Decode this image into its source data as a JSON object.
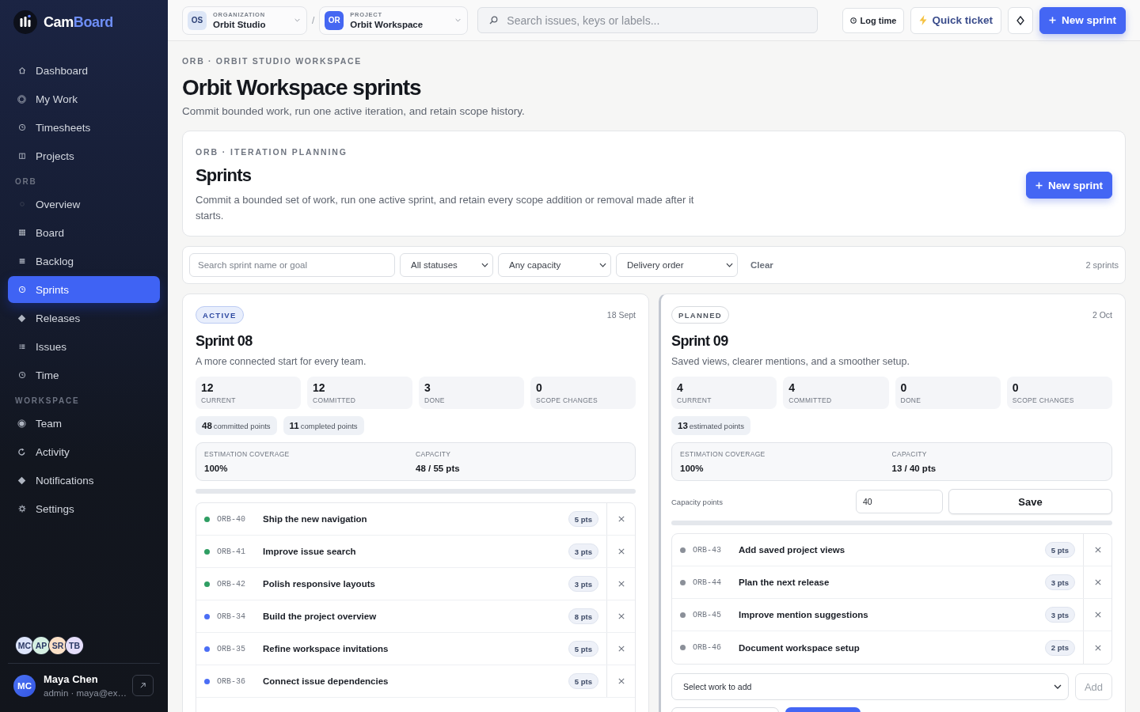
{
  "sidebar": {
    "brand": {
      "part_1": "Cam",
      "part_2": "Board"
    },
    "sections": [
      {
        "items": [
          {
            "label": "Dashboard",
            "selected": false
          },
          {
            "label": "My Work",
            "selected": false
          },
          {
            "label": "Timesheets",
            "selected": false
          },
          {
            "label": "Projects",
            "selected": false
          }
        ]
      },
      {
        "label": "ORB",
        "items": [
          {
            "label": "Overview",
            "selected": false
          },
          {
            "label": "Board",
            "selected": false
          },
          {
            "label": "Backlog",
            "selected": false
          },
          {
            "label": "Sprints",
            "selected": true
          },
          {
            "label": "Releases",
            "selected": false
          },
          {
            "label": "Issues",
            "selected": false
          },
          {
            "label": "Time",
            "selected": false
          }
        ]
      },
      {
        "label": "WORKSPACE",
        "items": [
          {
            "label": "Team",
            "selected": false
          },
          {
            "label": "Activity",
            "selected": false
          },
          {
            "label": "Notifications",
            "selected": false
          },
          {
            "label": "Settings",
            "selected": false
          }
        ]
      }
    ],
    "team": [
      {
        "initials": "MC",
        "color": "#dde5fb"
      },
      {
        "initials": "AP",
        "color": "#d5efe2"
      },
      {
        "initials": "SR",
        "color": "#fbe0c6"
      },
      {
        "initials": "TB",
        "color": "#e5defa"
      }
    ],
    "user": {
      "initials": "MC",
      "name": "Maya Chen",
      "detail": "admin · maya@ex…"
    }
  },
  "top_bar": {
    "organization": {
      "badge": "OS",
      "label": "ORGANIZATION",
      "name": "Orbit Studio"
    },
    "separator": "/",
    "project": {
      "badge": "OR",
      "label": "PROJECT",
      "name": "Orbit Workspace"
    },
    "search": {
      "placeholder": "Search issues, keys or labels..."
    },
    "buttons": [
      {
        "kind": "log",
        "label": "Log time"
      },
      {
        "kind": "quick",
        "label": "Quick ticket"
      },
      {
        "kind": "icon"
      },
      {
        "kind": "primary",
        "label": "New sprint"
      }
    ]
  },
  "page": {
    "breadcrumb": "ORB · ORBIT STUDIO WORKSPACE",
    "title": "Orbit Workspace sprints",
    "subtitle": "Commit bounded work, run one active iteration, and retain scope history."
  },
  "planning": {
    "eyebrow": "ORB · ITERATION PLANNING",
    "title": "Sprints",
    "description": "Commit a bounded set of work, run one active sprint, and retain every scope addition or removal made after it starts.",
    "button": "New sprint"
  },
  "filters": {
    "search": {
      "placeholder": "Search sprint name or goal"
    },
    "selects": [
      {
        "value": "All statuses"
      },
      {
        "value": "Any capacity"
      },
      {
        "value": "Delivery order"
      }
    ],
    "clear": "Clear",
    "count": "2 sprints"
  },
  "sprints": [
    {
      "badge": {
        "label": "ACTIVE",
        "kind": "active"
      },
      "date": "18 Sept",
      "title": "Sprint 08",
      "description": "A more connected start for every team.",
      "stats": [
        {
          "value": "12",
          "label": "CURRENT"
        },
        {
          "value": "12",
          "label": "COMMITTED"
        },
        {
          "value": "3",
          "label": "DONE"
        },
        {
          "value": "0",
          "label": "SCOPE CHANGES"
        }
      ],
      "chips": [
        "**48** committed points",
        "**11** completed points"
      ],
      "summary": [
        {
          "label": "ESTIMATION COVERAGE",
          "value": "100%"
        },
        {
          "label": "CAPACITY",
          "value": "48 / 55 pts"
        }
      ],
      "issues": [
        {
          "key": "ORB-40",
          "title": "Ship the new navigation",
          "points": "5 pts",
          "color": "#2f9e63"
        },
        {
          "key": "ORB-41",
          "title": "Improve issue search",
          "points": "3 pts",
          "color": "#2f9e63"
        },
        {
          "key": "ORB-42",
          "title": "Polish responsive layouts",
          "points": "3 pts",
          "color": "#2f9e63"
        },
        {
          "key": "ORB-34",
          "title": "Build the project overview",
          "points": "8 pts",
          "color": "#4b6ef5"
        },
        {
          "key": "ORB-35",
          "title": "Refine workspace invitations",
          "points": "5 pts",
          "color": "#4b6ef5"
        },
        {
          "key": "ORB-36",
          "title": "Connect issue dependencies",
          "points": "5 pts",
          "color": "#4b6ef5"
        }
      ]
    },
    {
      "badge": {
        "label": "PLANNED",
        "kind": "planned"
      },
      "date": "2 Oct",
      "title": "Sprint 09",
      "description": "Saved views, clearer mentions, and a smoother setup.",
      "stats": [
        {
          "value": "4",
          "label": "CURRENT"
        },
        {
          "value": "4",
          "label": "COMMITTED"
        },
        {
          "value": "0",
          "label": "DONE"
        },
        {
          "value": "0",
          "label": "SCOPE CHANGES"
        }
      ],
      "chips": [
        "**13** estimated points"
      ],
      "summary": [
        {
          "label": "ESTIMATION COVERAGE",
          "value": "100%"
        },
        {
          "label": "CAPACITY",
          "value": "13 / 40 pts"
        }
      ],
      "capacity_editor": {
        "label": "Capacity points",
        "value": "40",
        "button": "Save"
      },
      "issues": [
        {
          "key": "ORB-43",
          "title": "Add saved project views",
          "points": "5 pts",
          "color": "#8b9099"
        },
        {
          "key": "ORB-44",
          "title": "Plan the next release",
          "points": "3 pts",
          "color": "#8b9099"
        },
        {
          "key": "ORB-45",
          "title": "Improve mention suggestions",
          "points": "3 pts",
          "color": "#8b9099"
        },
        {
          "key": "ORB-46",
          "title": "Document workspace setup",
          "points": "2 pts",
          "color": "#8b9099"
        }
      ],
      "add_work": {
        "value": "Select work to add",
        "button": {
          "label": "Add",
          "disabled": true
        }
      },
      "footer_buttons": [
        {
          "kind": "secondary"
        },
        {
          "kind": "primary"
        }
      ]
    }
  ]
}
